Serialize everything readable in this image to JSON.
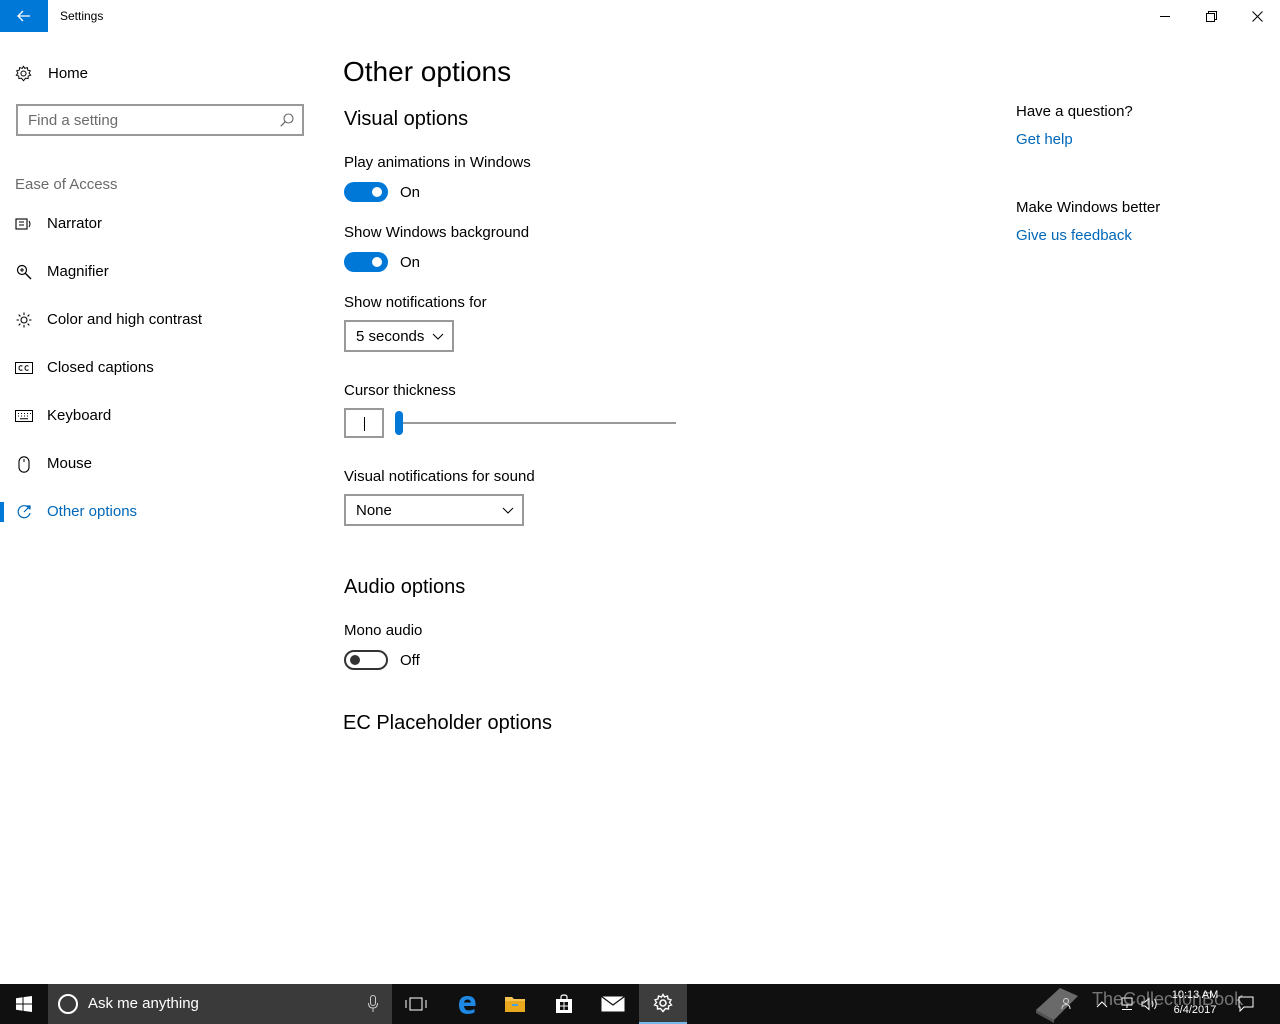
{
  "window": {
    "title": "Settings"
  },
  "sidebar": {
    "home_label": "Home",
    "search_placeholder": "Find a setting",
    "section_label": "Ease of Access",
    "items": [
      {
        "label": "Narrator",
        "icon": "narrator-icon"
      },
      {
        "label": "Magnifier",
        "icon": "magnifier-icon"
      },
      {
        "label": "Color and high contrast",
        "icon": "sun-icon"
      },
      {
        "label": "Closed captions",
        "icon": "cc-icon"
      },
      {
        "label": "Keyboard",
        "icon": "keyboard-icon"
      },
      {
        "label": "Mouse",
        "icon": "mouse-icon"
      },
      {
        "label": "Other options",
        "icon": "other-options-icon",
        "active": true
      }
    ]
  },
  "main": {
    "title": "Other options",
    "visual_heading": "Visual options",
    "play_animations": {
      "label": "Play animations in Windows",
      "state": "On"
    },
    "show_background": {
      "label": "Show Windows background",
      "state": "On"
    },
    "notifications": {
      "label": "Show notifications for",
      "value": "5 seconds"
    },
    "cursor": {
      "label": "Cursor thickness",
      "value": 1
    },
    "visual_sound": {
      "label": "Visual notifications for sound",
      "value": "None"
    },
    "audio_heading": "Audio options",
    "mono_audio": {
      "label": "Mono audio",
      "state": "Off"
    },
    "ec_heading": "EC Placeholder options"
  },
  "right_panel": {
    "question_heading": "Have a question?",
    "help_link": "Get help",
    "better_heading": "Make Windows better",
    "feedback_link": "Give us feedback"
  },
  "taskbar": {
    "search_placeholder": "Ask me anything",
    "time": "10:13 AM",
    "date": "6/4/2017",
    "watermark": "TheCollectionBook"
  },
  "colors": {
    "accent": "#0078d7",
    "link": "#0067b8",
    "taskbar": "#101010"
  }
}
